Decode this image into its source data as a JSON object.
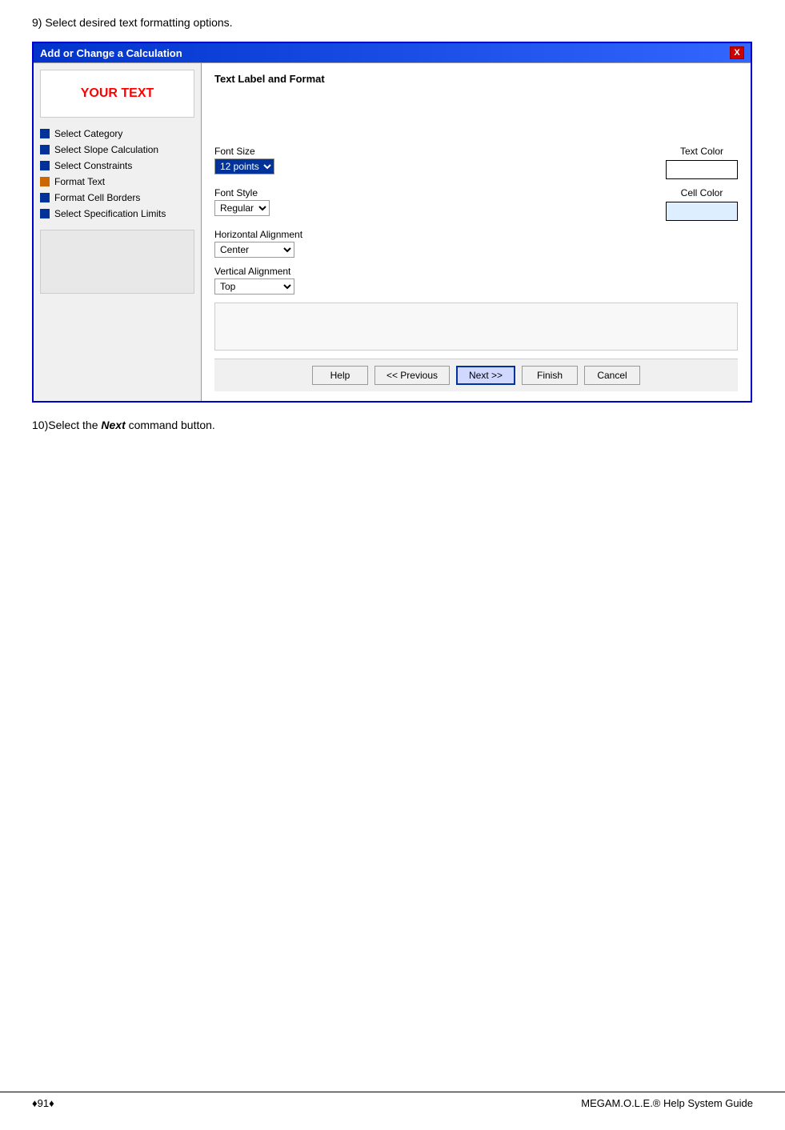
{
  "step9": {
    "text": "9)  Select desired text formatting options."
  },
  "step10": {
    "text": "10)Select the ",
    "bold": "Next",
    "text2": " command button."
  },
  "dialog": {
    "title": "Add or Change a Calculation",
    "close_btn": "X",
    "your_text": "YOUR TEXT",
    "section_title": "Text Label and Format",
    "nav_items": [
      {
        "label": "Select Category",
        "color": "blue"
      },
      {
        "label": "Select Slope Calculation",
        "color": "blue"
      },
      {
        "label": "Select Constraints",
        "color": "blue"
      },
      {
        "label": "Format Text",
        "color": "orange"
      },
      {
        "label": "Format Cell Borders",
        "color": "blue"
      },
      {
        "label": "Select Specification Limits",
        "color": "blue"
      }
    ],
    "font_size_label": "Font Size",
    "font_size_value": "12 points",
    "font_style_label": "Font Style",
    "font_style_value": "Regular",
    "h_align_label": "Horizontal Alignment",
    "h_align_value": "Center",
    "v_align_label": "Vertical Alignment",
    "v_align_value": "Top",
    "text_color_label": "Text Color",
    "cell_color_label": "Cell Color",
    "buttons": {
      "help": "Help",
      "previous": "<< Previous",
      "next": "Next >>",
      "finish": "Finish",
      "cancel": "Cancel"
    }
  },
  "footer": {
    "left": "♦91♦",
    "right": "MEGAM.O.L.E.® Help System Guide"
  }
}
